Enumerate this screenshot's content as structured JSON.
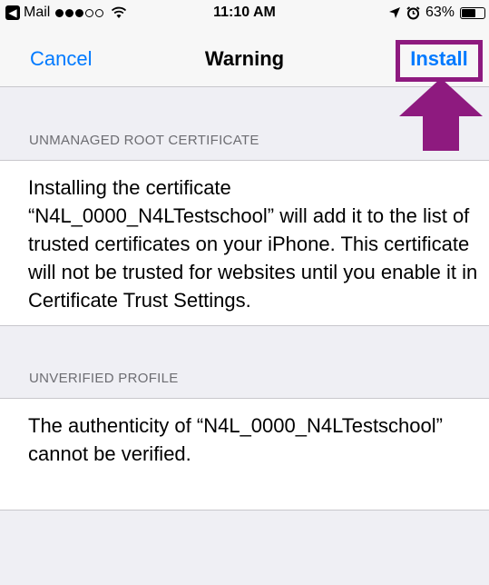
{
  "status_bar": {
    "app_name": "Mail",
    "time": "11:10 AM",
    "battery": "63%",
    "battery_level": 0.63,
    "signal_bars": 3,
    "signal_total": 5
  },
  "nav": {
    "cancel_label": "Cancel",
    "title": "Warning",
    "install_label": "Install"
  },
  "annotation": {
    "highlight_color": "#8e1a7f"
  },
  "sections": [
    {
      "header": "UNMANAGED ROOT CERTIFICATE",
      "body": "Installing the certificate “N4L_0000_N4LTestschool” will add it to the list of trusted certificates on your iPhone. This certificate will not be trusted for websites until you enable it in Certificate Trust Settings."
    },
    {
      "header": "UNVERIFIED PROFILE",
      "body": "The authenticity of “N4L_0000_N4LTestschool” cannot be verified."
    }
  ],
  "colors": {
    "accent": "#007aff",
    "background": "#efeff4"
  }
}
